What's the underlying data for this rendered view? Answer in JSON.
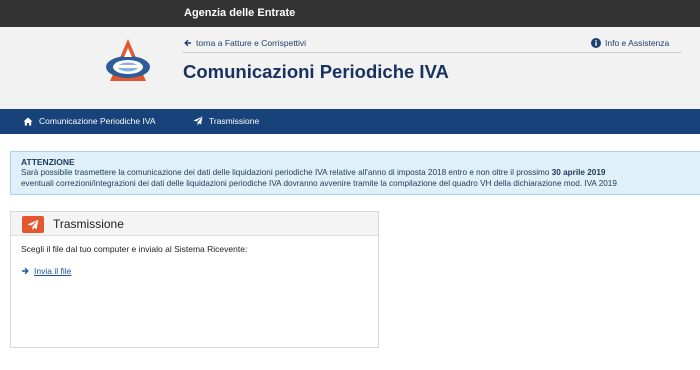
{
  "topbar": {
    "brand": "Agenzia delle Entrate"
  },
  "header": {
    "back_link": "torna a Fatture e Corrispettivi",
    "info_link": "Info e Assistenza",
    "title": "Comunicazioni Periodiche IVA"
  },
  "nav": {
    "items": [
      {
        "label": "Comunicazione Periodiche IVA",
        "icon": "home-icon"
      },
      {
        "label": "Trasmissione",
        "icon": "paper-plane-icon"
      }
    ]
  },
  "alert": {
    "title": "ATTENZIONE",
    "line1_prefix": "Sarà possibile trasmettere la comunicazione dei dati delle liquidazioni periodiche IVA relative all'anno di imposta 2018 entro e non oltre il prossimo ",
    "line1_bold": "30 aprile 2019",
    "line2": "eventuali correzioni/integrazioni dei dati delle liquidazioni periodiche IVA dovranno avvenire tramite la compilazione del quadro VH della dichiarazione mod. IVA 2019"
  },
  "panel": {
    "title": "Trasmissione",
    "description": "Scegli il file dal tuo computer e invialo al Sistema Ricevente:",
    "link": "Invia il file"
  },
  "colors": {
    "accent": "#e4572e",
    "nav": "#17427a",
    "title": "#17325e"
  }
}
